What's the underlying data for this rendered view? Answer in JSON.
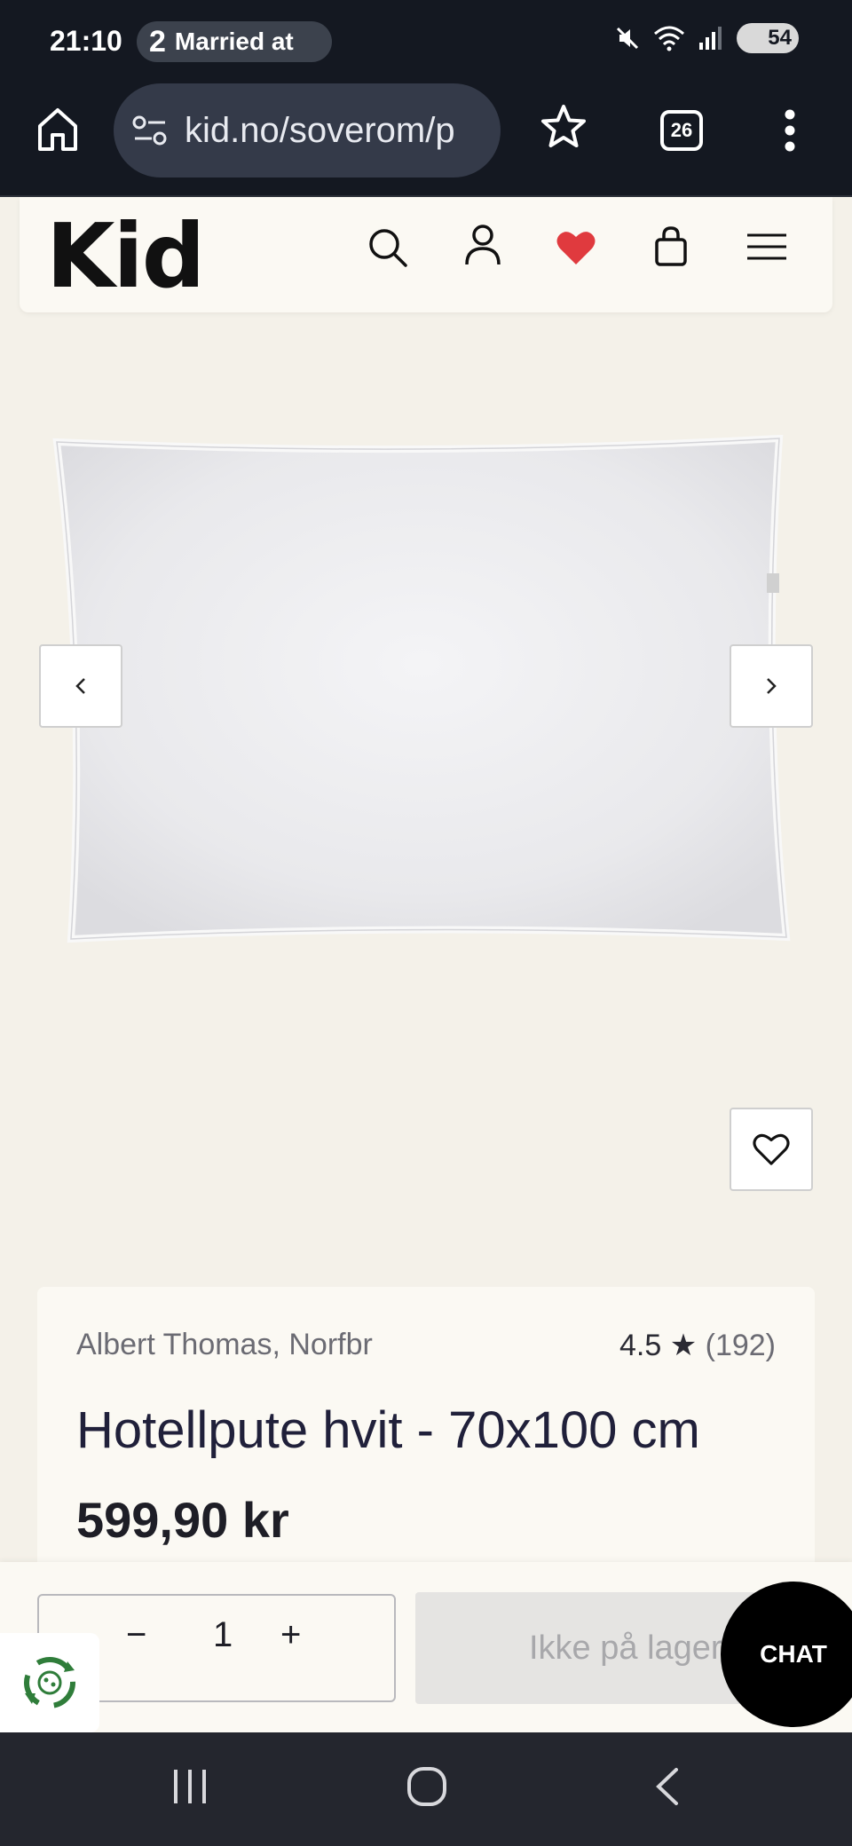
{
  "status": {
    "time": "21:10",
    "notification_icon": "2",
    "notification_text": "Married at",
    "battery": "54"
  },
  "browser": {
    "url": "kid.no/soverom/p",
    "tab_count": "26"
  },
  "header": {
    "logo": "Kid"
  },
  "product": {
    "brand": "Albert Thomas, Norfbr",
    "rating": "4.5",
    "rating_count": "(192)",
    "title": "Hotellpute hvit - 70x100 cm",
    "price": "599,90 kr"
  },
  "purchase": {
    "minus_label": "−",
    "quantity": "1",
    "plus_label": "+",
    "stock_label": "Ikke på lager",
    "chat_label": "CHAT"
  },
  "colors": {
    "page_bg": "#f4f1e9",
    "card_bg": "#fbf9f3",
    "heart_red": "#e03a3e",
    "chrome_dark": "#141821"
  }
}
